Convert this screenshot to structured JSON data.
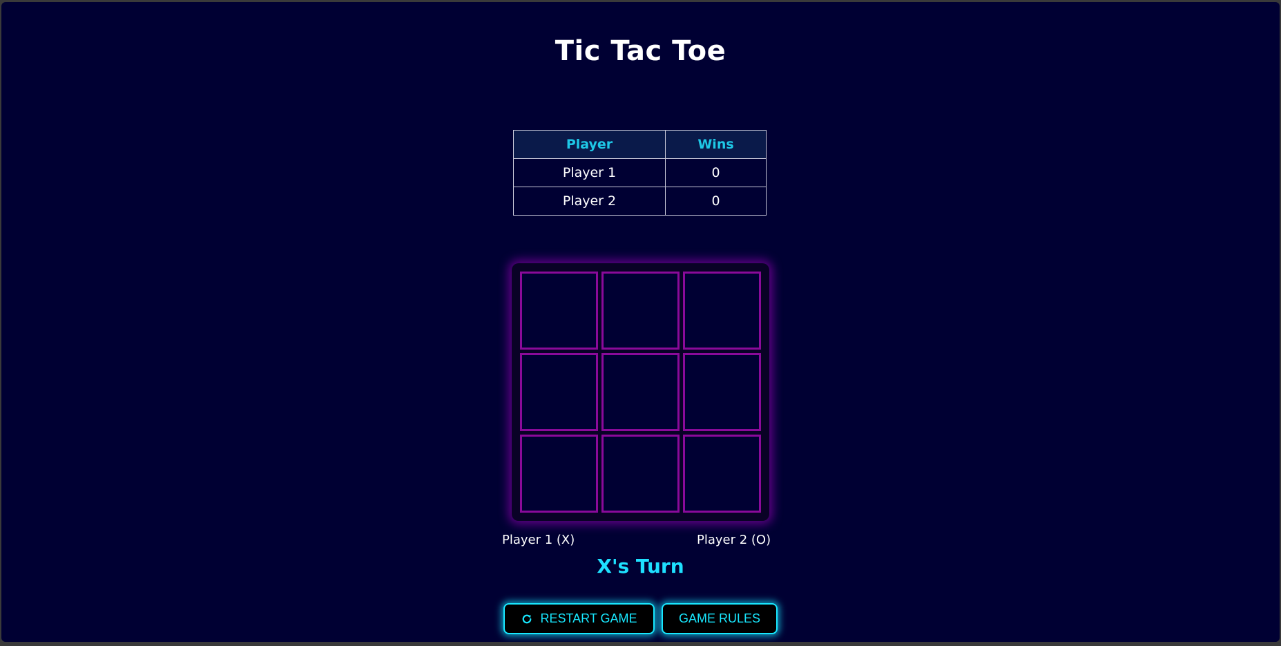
{
  "app": {
    "title": "Tic Tac Toe"
  },
  "scoreboard": {
    "headers": [
      "Player",
      "Wins"
    ],
    "rows": [
      {
        "player": "Player 1",
        "wins": "0"
      },
      {
        "player": "Player 2",
        "wins": "0"
      }
    ]
  },
  "board": {
    "cells": [
      "",
      "",
      "",
      "",
      "",
      "",
      "",
      "",
      ""
    ]
  },
  "players": {
    "left": "Player 1 (X)",
    "right": "Player 2 (O)"
  },
  "status": {
    "turn_text": "X's Turn"
  },
  "buttons": {
    "restart_label": "RESTART GAME",
    "restart_icon": "redo-icon",
    "rules_label": "GAME RULES"
  },
  "colors": {
    "background": "#000033",
    "accent_cyan": "#18e8ff",
    "board_glow": "#8a0a9a",
    "header_text": "#1ec8e6"
  }
}
